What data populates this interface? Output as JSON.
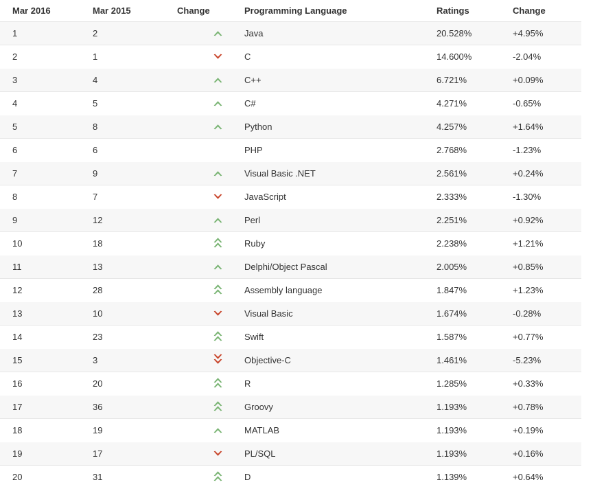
{
  "table": {
    "name": "tiobe-index-table",
    "columns": [
      {
        "key": "rank_new",
        "label": "Mar 2016"
      },
      {
        "key": "rank_old",
        "label": "Mar 2015"
      },
      {
        "key": "change_icon",
        "label": "Change"
      },
      {
        "key": "language",
        "label": "Programming Language"
      },
      {
        "key": "ratings",
        "label": "Ratings"
      },
      {
        "key": "delta",
        "label": "Change"
      }
    ],
    "colors": {
      "up": "#79b473",
      "up_strong": "#79b473",
      "down": "#c8452b",
      "down_strong": "#c8452b",
      "text": "#333333",
      "stripe": "#f7f7f7",
      "row_border": "#e7e7e7",
      "background": "#ffffff"
    },
    "rows": [
      {
        "rank_new": "1",
        "rank_old": "2",
        "change": "up",
        "language": "Java",
        "ratings": "20.528%",
        "delta": "+4.95%"
      },
      {
        "rank_new": "2",
        "rank_old": "1",
        "change": "down",
        "language": "C",
        "ratings": "14.600%",
        "delta": "-2.04%"
      },
      {
        "rank_new": "3",
        "rank_old": "4",
        "change": "up",
        "language": "C++",
        "ratings": "6.721%",
        "delta": "+0.09%"
      },
      {
        "rank_new": "4",
        "rank_old": "5",
        "change": "up",
        "language": "C#",
        "ratings": "4.271%",
        "delta": "-0.65%"
      },
      {
        "rank_new": "5",
        "rank_old": "8",
        "change": "up",
        "language": "Python",
        "ratings": "4.257%",
        "delta": "+1.64%"
      },
      {
        "rank_new": "6",
        "rank_old": "6",
        "change": "none",
        "language": "PHP",
        "ratings": "2.768%",
        "delta": "-1.23%"
      },
      {
        "rank_new": "7",
        "rank_old": "9",
        "change": "up",
        "language": "Visual Basic .NET",
        "ratings": "2.561%",
        "delta": "+0.24%"
      },
      {
        "rank_new": "8",
        "rank_old": "7",
        "change": "down",
        "language": "JavaScript",
        "ratings": "2.333%",
        "delta": "-1.30%"
      },
      {
        "rank_new": "9",
        "rank_old": "12",
        "change": "up",
        "language": "Perl",
        "ratings": "2.251%",
        "delta": "+0.92%"
      },
      {
        "rank_new": "10",
        "rank_old": "18",
        "change": "up-double",
        "language": "Ruby",
        "ratings": "2.238%",
        "delta": "+1.21%"
      },
      {
        "rank_new": "11",
        "rank_old": "13",
        "change": "up",
        "language": "Delphi/Object Pascal",
        "ratings": "2.005%",
        "delta": "+0.85%"
      },
      {
        "rank_new": "12",
        "rank_old": "28",
        "change": "up-double",
        "language": "Assembly language",
        "ratings": "1.847%",
        "delta": "+1.23%"
      },
      {
        "rank_new": "13",
        "rank_old": "10",
        "change": "down",
        "language": "Visual Basic",
        "ratings": "1.674%",
        "delta": "-0.28%"
      },
      {
        "rank_new": "14",
        "rank_old": "23",
        "change": "up-double",
        "language": "Swift",
        "ratings": "1.587%",
        "delta": "+0.77%"
      },
      {
        "rank_new": "15",
        "rank_old": "3",
        "change": "down-double",
        "language": "Objective-C",
        "ratings": "1.461%",
        "delta": "-5.23%"
      },
      {
        "rank_new": "16",
        "rank_old": "20",
        "change": "up-double",
        "language": "R",
        "ratings": "1.285%",
        "delta": "+0.33%"
      },
      {
        "rank_new": "17",
        "rank_old": "36",
        "change": "up-double",
        "language": "Groovy",
        "ratings": "1.193%",
        "delta": "+0.78%"
      },
      {
        "rank_new": "18",
        "rank_old": "19",
        "change": "up",
        "language": "MATLAB",
        "ratings": "1.193%",
        "delta": "+0.19%"
      },
      {
        "rank_new": "19",
        "rank_old": "17",
        "change": "down",
        "language": "PL/SQL",
        "ratings": "1.193%",
        "delta": "+0.16%"
      },
      {
        "rank_new": "20",
        "rank_old": "31",
        "change": "up-double",
        "language": "D",
        "ratings": "1.139%",
        "delta": "+0.64%"
      }
    ],
    "icon_names": {
      "up": "chevron-up-icon",
      "up-double": "chevron-double-up-icon",
      "down": "chevron-down-icon",
      "down-double": "chevron-double-down-icon",
      "none": "no-change-icon"
    }
  }
}
